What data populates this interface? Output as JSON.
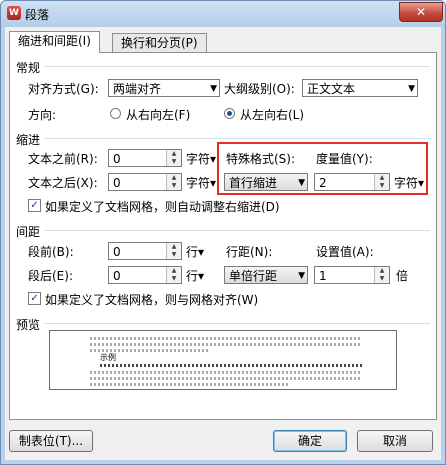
{
  "title": "段落",
  "app_icon_glyph": "W",
  "close_glyph": "✕",
  "tabs": [
    {
      "label": "缩进和间距(I)"
    },
    {
      "label": "换行和分页(P)"
    }
  ],
  "general": {
    "heading": "常规",
    "alignment_label": "对齐方式(G):",
    "alignment_value": "两端对齐",
    "outline_label": "大纲级别(O):",
    "outline_value": "正文文本",
    "direction_label": "方向:",
    "rtl_label": "从右向左(F)",
    "ltr_label": "从左向右(L)"
  },
  "indent": {
    "heading": "缩进",
    "before_label": "文本之前(R):",
    "before_value": "0",
    "before_unit": "字符▾",
    "after_label": "文本之后(X):",
    "after_value": "0",
    "after_unit": "字符▾",
    "special_label": "特殊格式(S):",
    "special_value": "首行缩进",
    "measure_label": "度量值(Y):",
    "measure_value": "2",
    "measure_unit": "字符▾",
    "grid_check_label": "如果定义了文档网格，则自动调整右缩进(D)"
  },
  "spacing": {
    "heading": "间距",
    "before_label": "段前(B):",
    "before_value": "0",
    "before_unit": "行▾",
    "after_label": "段后(E):",
    "after_value": "0",
    "after_unit": "行▾",
    "line_label": "行距(N):",
    "line_value": "单倍行距",
    "setting_label": "设置值(A):",
    "setting_value": "1",
    "setting_unit": "倍",
    "grid_check_label": "如果定义了文档网格，则与网格对齐(W)"
  },
  "preview": {
    "heading": "预览",
    "sample_text": "示例"
  },
  "buttons": {
    "tabs": "制表位(T)...",
    "ok": "确定",
    "cancel": "取消"
  },
  "colors": {
    "highlight_box": "#e3302a",
    "title_bar": "#b9d1ea"
  }
}
